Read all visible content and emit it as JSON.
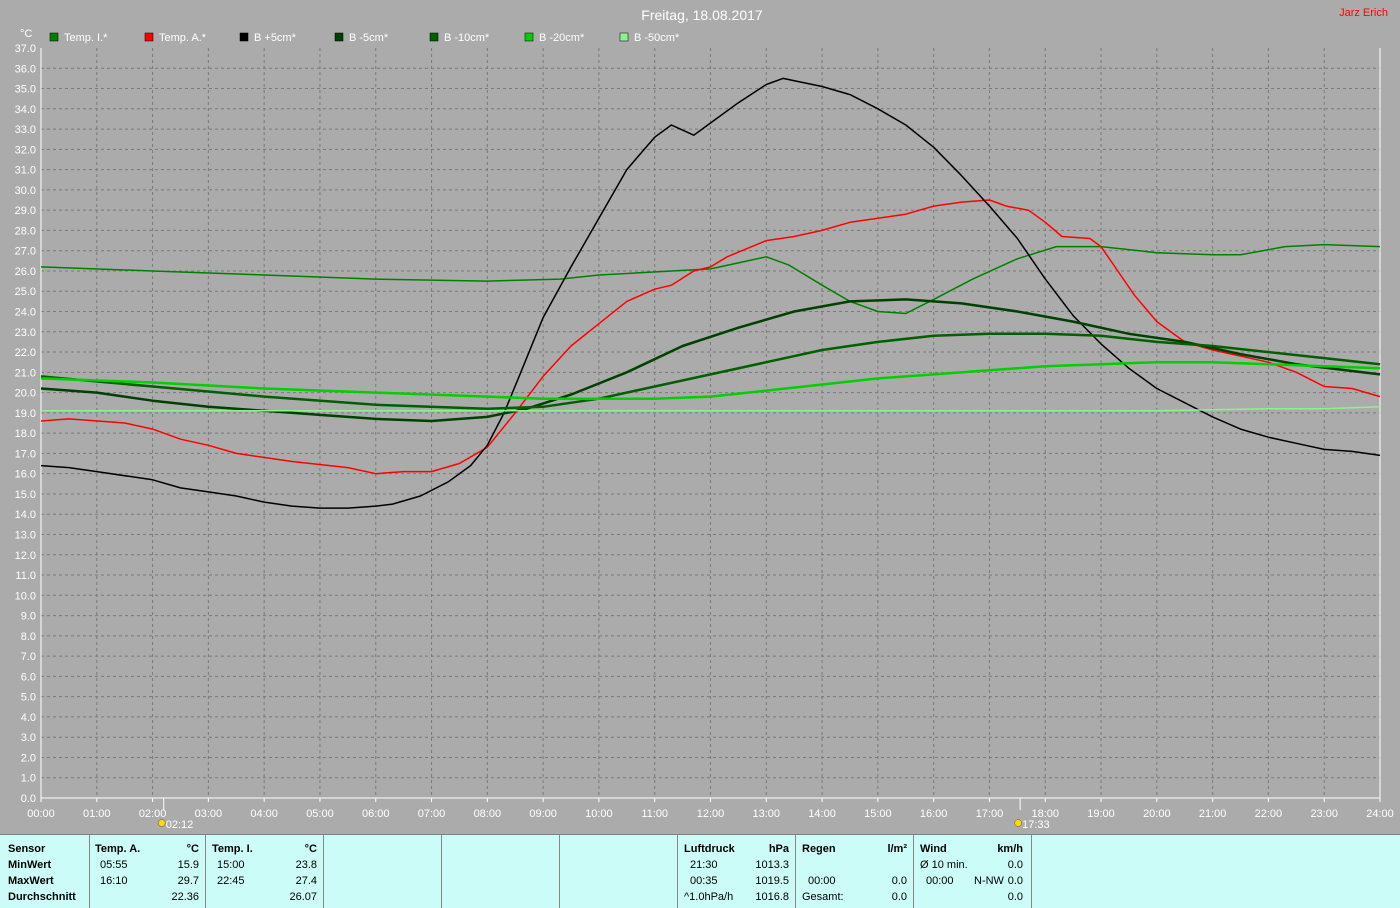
{
  "chart_data": {
    "type": "line",
    "title": "Freitag, 18.08.2017",
    "author": "Jarz Erich",
    "ylabel": "°C",
    "xlabel": "",
    "ylim": [
      0,
      37
    ],
    "xlim": [
      0,
      24
    ],
    "grid": true,
    "legend_position": "top-left",
    "x_ticks": [
      "00:00",
      "01:00",
      "02:00",
      "03:00",
      "04:00",
      "05:00",
      "06:00",
      "07:00",
      "08:00",
      "09:00",
      "10:00",
      "11:00",
      "12:00",
      "13:00",
      "14:00",
      "15:00",
      "16:00",
      "17:00",
      "18:00",
      "19:00",
      "20:00",
      "21:00",
      "22:00",
      "23:00",
      "24:00"
    ],
    "markers": [
      {
        "time": 2.2,
        "label": "02:12",
        "icon": "moon-icon"
      },
      {
        "time": 17.55,
        "label": "17:33",
        "icon": "sun-icon"
      }
    ],
    "series": [
      {
        "name": "Temp. I.*",
        "color": "#008000",
        "width": 1.5,
        "points": [
          [
            0,
            26.2
          ],
          [
            2,
            26.0
          ],
          [
            4,
            25.8
          ],
          [
            6,
            25.6
          ],
          [
            8,
            25.5
          ],
          [
            9.3,
            25.6
          ],
          [
            10,
            25.8
          ],
          [
            12,
            26.1
          ],
          [
            12.5,
            26.4
          ],
          [
            13,
            26.7
          ],
          [
            13.4,
            26.3
          ],
          [
            14,
            25.3
          ],
          [
            14.5,
            24.5
          ],
          [
            15,
            24.0
          ],
          [
            15.5,
            23.9
          ],
          [
            16,
            24.6
          ],
          [
            16.7,
            25.6
          ],
          [
            17.5,
            26.6
          ],
          [
            18.2,
            27.2
          ],
          [
            19,
            27.2
          ],
          [
            20,
            26.9
          ],
          [
            21,
            26.8
          ],
          [
            21.5,
            26.8
          ],
          [
            22.3,
            27.2
          ],
          [
            23,
            27.3
          ],
          [
            24,
            27.2
          ]
        ]
      },
      {
        "name": "Temp. A.*",
        "color": "#ff0000",
        "width": 1.5,
        "points": [
          [
            0,
            18.6
          ],
          [
            0.5,
            18.7
          ],
          [
            1.5,
            18.5
          ],
          [
            2,
            18.2
          ],
          [
            2.5,
            17.7
          ],
          [
            3,
            17.4
          ],
          [
            3.5,
            17.0
          ],
          [
            4.5,
            16.6
          ],
          [
            5.5,
            16.3
          ],
          [
            6,
            16.0
          ],
          [
            6.5,
            16.1
          ],
          [
            7,
            16.1
          ],
          [
            7.5,
            16.5
          ],
          [
            8,
            17.3
          ],
          [
            8.5,
            19.0
          ],
          [
            9,
            20.8
          ],
          [
            9.5,
            22.3
          ],
          [
            10,
            23.4
          ],
          [
            10.5,
            24.5
          ],
          [
            11,
            25.1
          ],
          [
            11.3,
            25.3
          ],
          [
            11.7,
            26.0
          ],
          [
            12,
            26.2
          ],
          [
            12.3,
            26.7
          ],
          [
            13,
            27.5
          ],
          [
            13.5,
            27.7
          ],
          [
            14,
            28.0
          ],
          [
            14.5,
            28.4
          ],
          [
            15.5,
            28.8
          ],
          [
            16,
            29.2
          ],
          [
            16.5,
            29.4
          ],
          [
            17,
            29.5
          ],
          [
            17.3,
            29.2
          ],
          [
            17.7,
            29.0
          ],
          [
            18,
            28.4
          ],
          [
            18.3,
            27.7
          ],
          [
            18.8,
            27.6
          ],
          [
            19,
            27.2
          ],
          [
            19.3,
            26.0
          ],
          [
            19.6,
            24.8
          ],
          [
            20,
            23.5
          ],
          [
            20.5,
            22.5
          ],
          [
            21,
            22.1
          ],
          [
            22,
            21.5
          ],
          [
            22.5,
            21.0
          ],
          [
            23,
            20.3
          ],
          [
            23.5,
            20.2
          ],
          [
            24,
            19.8
          ]
        ]
      },
      {
        "name": "B +5cm*",
        "color": "#000000",
        "width": 1.5,
        "points": [
          [
            0,
            16.4
          ],
          [
            0.5,
            16.3
          ],
          [
            1,
            16.1
          ],
          [
            2,
            15.7
          ],
          [
            2.5,
            15.3
          ],
          [
            3,
            15.1
          ],
          [
            3.5,
            14.9
          ],
          [
            4,
            14.6
          ],
          [
            4.5,
            14.4
          ],
          [
            5,
            14.3
          ],
          [
            5.5,
            14.3
          ],
          [
            6,
            14.4
          ],
          [
            6.3,
            14.5
          ],
          [
            6.8,
            14.9
          ],
          [
            7.3,
            15.6
          ],
          [
            7.7,
            16.4
          ],
          [
            8,
            17.4
          ],
          [
            8.3,
            19.0
          ],
          [
            8.6,
            21.0
          ],
          [
            9,
            23.7
          ],
          [
            9.5,
            26.2
          ],
          [
            10,
            28.6
          ],
          [
            10.5,
            31.0
          ],
          [
            11,
            32.6
          ],
          [
            11.3,
            33.2
          ],
          [
            11.7,
            32.7
          ],
          [
            12,
            33.3
          ],
          [
            12.5,
            34.3
          ],
          [
            13,
            35.2
          ],
          [
            13.3,
            35.5
          ],
          [
            14,
            35.1
          ],
          [
            14.5,
            34.7
          ],
          [
            15,
            34.0
          ],
          [
            15.5,
            33.2
          ],
          [
            16,
            32.1
          ],
          [
            16.5,
            30.7
          ],
          [
            17,
            29.2
          ],
          [
            17.5,
            27.6
          ],
          [
            18,
            25.6
          ],
          [
            18.5,
            23.8
          ],
          [
            19,
            22.4
          ],
          [
            19.5,
            21.2
          ],
          [
            20,
            20.2
          ],
          [
            20.5,
            19.5
          ],
          [
            21,
            18.8
          ],
          [
            21.5,
            18.2
          ],
          [
            22,
            17.8
          ],
          [
            22.5,
            17.5
          ],
          [
            23,
            17.2
          ],
          [
            23.5,
            17.1
          ],
          [
            24,
            16.9
          ]
        ]
      },
      {
        "name": "B -5cm*",
        "color": "#004000",
        "width": 2.5,
        "points": [
          [
            0,
            20.2
          ],
          [
            1,
            20.0
          ],
          [
            2,
            19.6
          ],
          [
            3,
            19.3
          ],
          [
            4,
            19.1
          ],
          [
            5,
            18.9
          ],
          [
            6,
            18.7
          ],
          [
            7,
            18.6
          ],
          [
            8,
            18.8
          ],
          [
            8.7,
            19.2
          ],
          [
            9.5,
            19.9
          ],
          [
            10.5,
            21.0
          ],
          [
            11.5,
            22.3
          ],
          [
            12.5,
            23.2
          ],
          [
            13.5,
            24.0
          ],
          [
            14.5,
            24.5
          ],
          [
            15.5,
            24.6
          ],
          [
            16.5,
            24.4
          ],
          [
            17.5,
            24.0
          ],
          [
            18.5,
            23.5
          ],
          [
            19.5,
            22.9
          ],
          [
            20.5,
            22.5
          ],
          [
            21.5,
            21.9
          ],
          [
            22.5,
            21.4
          ],
          [
            24,
            20.9
          ]
        ]
      },
      {
        "name": "B -10cm*",
        "color": "#006000",
        "width": 2.5,
        "points": [
          [
            0,
            20.8
          ],
          [
            2,
            20.3
          ],
          [
            4,
            19.8
          ],
          [
            6,
            19.4
          ],
          [
            8,
            19.2
          ],
          [
            9,
            19.3
          ],
          [
            10,
            19.7
          ],
          [
            11,
            20.3
          ],
          [
            12,
            20.9
          ],
          [
            13,
            21.5
          ],
          [
            14,
            22.1
          ],
          [
            15,
            22.5
          ],
          [
            16,
            22.8
          ],
          [
            17,
            22.9
          ],
          [
            18,
            22.9
          ],
          [
            19,
            22.8
          ],
          [
            20,
            22.5
          ],
          [
            21,
            22.3
          ],
          [
            22,
            22.0
          ],
          [
            23,
            21.7
          ],
          [
            24,
            21.4
          ]
        ]
      },
      {
        "name": "B -20cm*",
        "color": "#00d000",
        "width": 2.5,
        "points": [
          [
            0,
            20.7
          ],
          [
            2,
            20.5
          ],
          [
            4,
            20.2
          ],
          [
            6,
            20.0
          ],
          [
            8,
            19.8
          ],
          [
            9,
            19.7
          ],
          [
            10,
            19.7
          ],
          [
            11,
            19.7
          ],
          [
            12,
            19.8
          ],
          [
            13,
            20.1
          ],
          [
            14,
            20.4
          ],
          [
            15,
            20.7
          ],
          [
            16,
            20.9
          ],
          [
            17,
            21.1
          ],
          [
            18,
            21.3
          ],
          [
            19,
            21.4
          ],
          [
            20,
            21.5
          ],
          [
            21,
            21.5
          ],
          [
            22,
            21.4
          ],
          [
            23,
            21.3
          ],
          [
            24,
            21.2
          ]
        ]
      },
      {
        "name": "B -50cm*",
        "color": "#90f090",
        "width": 1.5,
        "points": [
          [
            0,
            19.1
          ],
          [
            6,
            19.1
          ],
          [
            12,
            19.1
          ],
          [
            18,
            19.1
          ],
          [
            20,
            19.1
          ],
          [
            22,
            19.2
          ],
          [
            23,
            19.2
          ],
          [
            24,
            19.3
          ]
        ]
      }
    ]
  },
  "stats": {
    "sensor": {
      "header": "Sensor",
      "rows": [
        "MinWert",
        "MaxWert",
        "Durchschnitt"
      ]
    },
    "temp_a": {
      "header": "Temp. A.",
      "unit": "°C",
      "min_time": "05:55",
      "min_val": "15.9",
      "max_time": "16:10",
      "max_val": "29.7",
      "avg": "22.36"
    },
    "temp_i": {
      "header": "Temp. I.",
      "unit": "°C",
      "min_time": "15:00",
      "min_val": "23.8",
      "max_time": "22:45",
      "max_val": "27.4",
      "avg": "26.07"
    },
    "pressure": {
      "header": "Luftdruck",
      "unit": "hPa",
      "min_time": "21:30",
      "min_val": "1013.3",
      "max_time": "00:35",
      "max_val": "1019.5",
      "trend": "^1.0hPa/h",
      "avg": "1016.8"
    },
    "rain": {
      "header": "Regen",
      "unit": "l/m²",
      "max_time": "00:00",
      "max_val": "0.0",
      "total_label": "Gesamt:",
      "total": "0.0"
    },
    "wind": {
      "header": "Wind",
      "unit": "km/h",
      "avg_label": "Ø 10 min.",
      "avg_val": "0.0",
      "max_time": "00:00",
      "max_dir": "N-NW",
      "max_val": "0.0",
      "last_val": "0.0"
    }
  }
}
